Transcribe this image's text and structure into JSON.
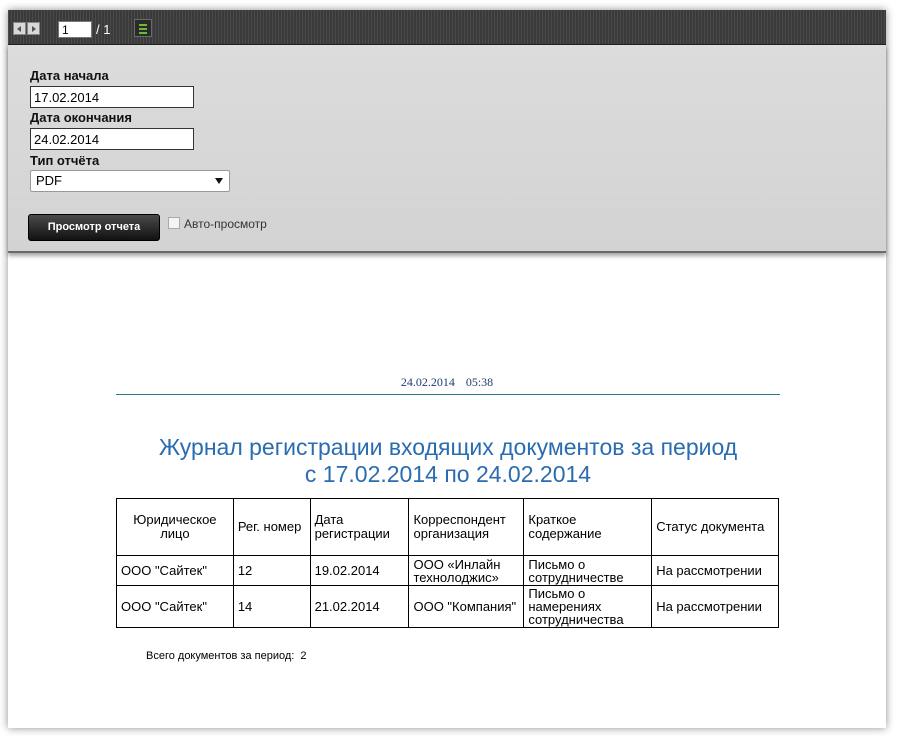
{
  "toolbar": {
    "page_value": "1",
    "page_total": "/ 1"
  },
  "params": {
    "start_date_label": "Дата начала",
    "start_date_value": "17.02.2014",
    "end_date_label": "Дата окончания",
    "end_date_value": "24.02.2014",
    "report_type_label": "Тип отчёта",
    "report_type_selected": "PDF",
    "view_button_label": "Просмотр отчета",
    "auto_view_label": "Авто-просмотр",
    "auto_view_checked": false
  },
  "report": {
    "timestamp": "24.02.2014 05:38",
    "title_line1": "Журнал регистрации входящих документов за период",
    "title_line2": "с 17.02.2014 по 24.02.2014",
    "columns": [
      "Юридическое лицо",
      "Рег. номер",
      "Дата регистрации",
      "Корреспондент организация",
      "Краткое содержание",
      "Статус документа"
    ],
    "rows": [
      [
        "ООО \"Сайтек\"",
        "12",
        "19.02.2014",
        "ООО «Инлайн технолоджис»",
        "Письмо о сотрудничестве",
        "На рассмотрении"
      ],
      [
        "ООО \"Сайтек\"",
        "14",
        "21.02.2014",
        "ООО \"Компания\"",
        "Письмо о намерениях сотрудничества",
        "На рассмотрении"
      ]
    ],
    "total_label": "Всего документов за период:",
    "total_value": "2"
  }
}
